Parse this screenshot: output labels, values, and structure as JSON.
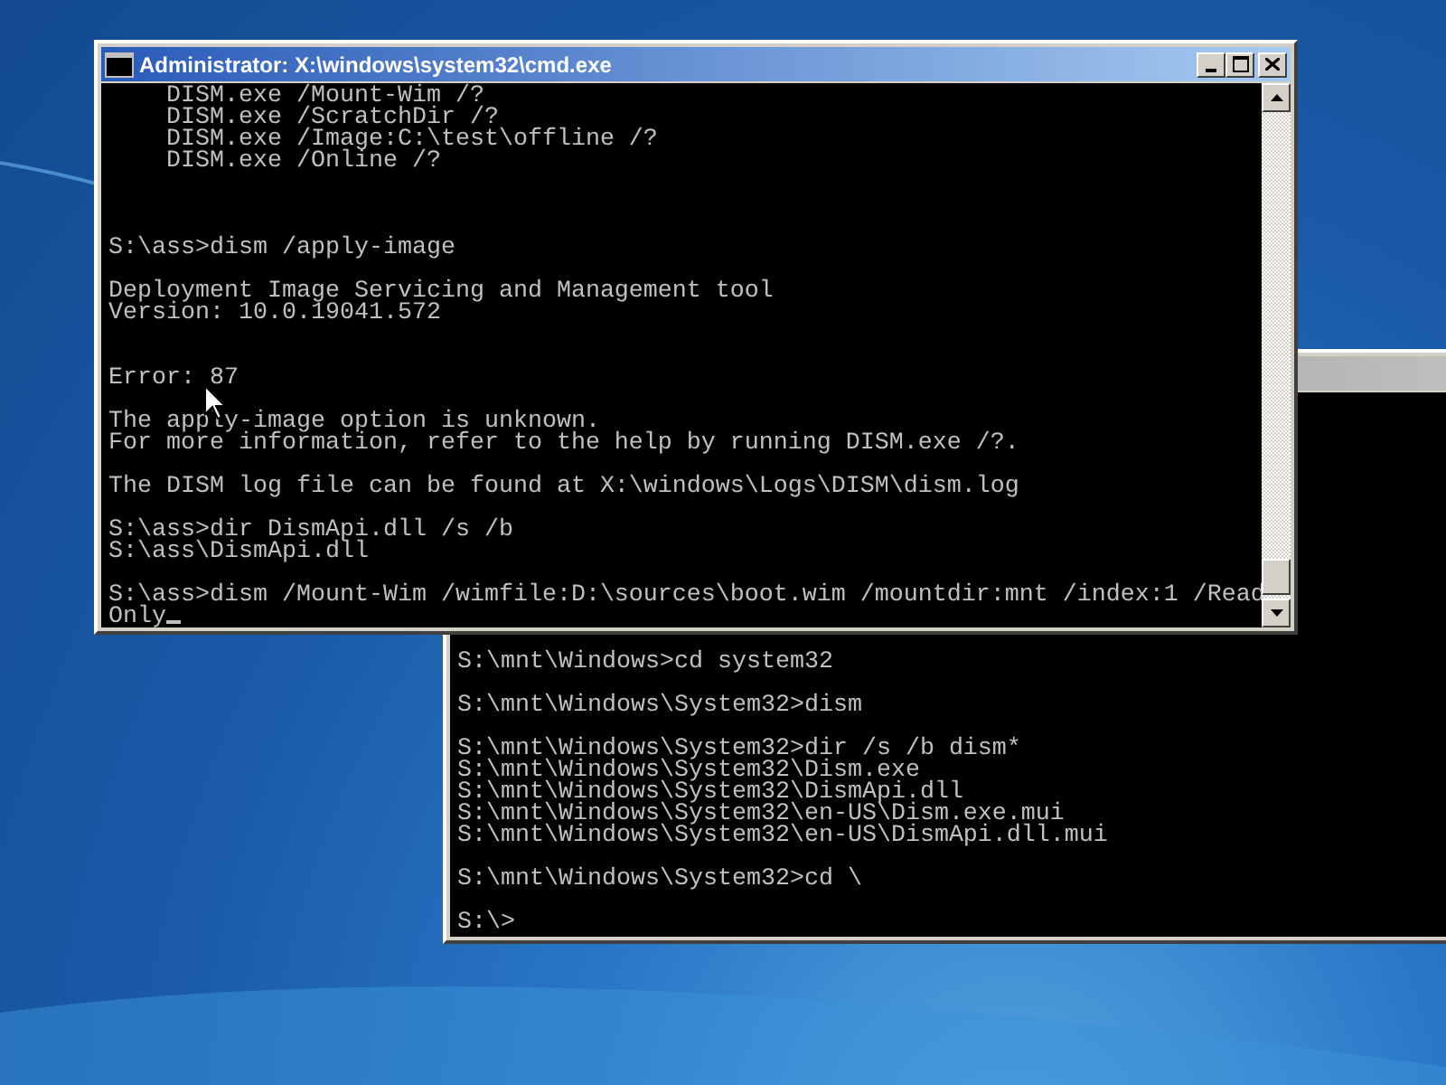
{
  "windows": [
    {
      "active": false,
      "caret_visible": false,
      "lines": [
        {
          "kind": "text",
          "text": "S:\\mnt\\Windows>cd system32"
        },
        {
          "kind": "blank"
        },
        {
          "kind": "text",
          "text": "S:\\mnt\\Windows\\System32>dism"
        },
        {
          "kind": "blank"
        },
        {
          "kind": "text",
          "text": "S:\\mnt\\Windows\\System32>dir /s /b dism*"
        },
        {
          "kind": "text",
          "text": "S:\\mnt\\Windows\\System32\\Dism.exe"
        },
        {
          "kind": "text",
          "text": "S:\\mnt\\Windows\\System32\\DismApi.dll"
        },
        {
          "kind": "text",
          "text": "S:\\mnt\\Windows\\System32\\en-US\\Dism.exe.mui"
        },
        {
          "kind": "text",
          "text": "S:\\mnt\\Windows\\System32\\en-US\\DismApi.dll.mui"
        },
        {
          "kind": "blank"
        },
        {
          "kind": "text",
          "text": "S:\\mnt\\Windows\\System32>cd \\"
        },
        {
          "kind": "blank"
        },
        {
          "kind": "text",
          "text": "S:\\>"
        }
      ]
    },
    {
      "title": "Administrator: X:\\windows\\system32\\cmd.exe",
      "active": true,
      "caret_visible": true,
      "lines": [
        {
          "kind": "text",
          "text": "    DISM.exe /Mount-Wim /?"
        },
        {
          "kind": "text",
          "text": "    DISM.exe /ScratchDir /?"
        },
        {
          "kind": "text",
          "text": "    DISM.exe /Image:C:\\test\\offline /?"
        },
        {
          "kind": "text",
          "text": "    DISM.exe /Online /?"
        },
        {
          "kind": "blank"
        },
        {
          "kind": "blank"
        },
        {
          "kind": "blank"
        },
        {
          "kind": "text",
          "text": "S:\\ass>dism /apply-image"
        },
        {
          "kind": "blank"
        },
        {
          "kind": "text",
          "text": "Deployment Image Servicing and Management tool"
        },
        {
          "kind": "text",
          "text": "Version: 10.0.19041.572"
        },
        {
          "kind": "blank"
        },
        {
          "kind": "blank"
        },
        {
          "kind": "text",
          "text": "Error: 87"
        },
        {
          "kind": "blank"
        },
        {
          "kind": "text",
          "text": "The apply-image option is unknown."
        },
        {
          "kind": "text",
          "text": "For more information, refer to the help by running DISM.exe /?."
        },
        {
          "kind": "blank"
        },
        {
          "kind": "text",
          "text": "The DISM log file can be found at X:\\windows\\Logs\\DISM\\dism.log"
        },
        {
          "kind": "blank"
        },
        {
          "kind": "text",
          "text": "S:\\ass>dir DismApi.dll /s /b"
        },
        {
          "kind": "text",
          "text": "S:\\ass\\DismApi.dll"
        },
        {
          "kind": "blank"
        },
        {
          "kind": "text",
          "text": "S:\\ass>dism /Mount-Wim /wimfile:D:\\sources\\boot.wim /mountdir:mnt /index:1 /Read"
        },
        {
          "kind": "text",
          "text": "Only"
        }
      ]
    }
  ]
}
